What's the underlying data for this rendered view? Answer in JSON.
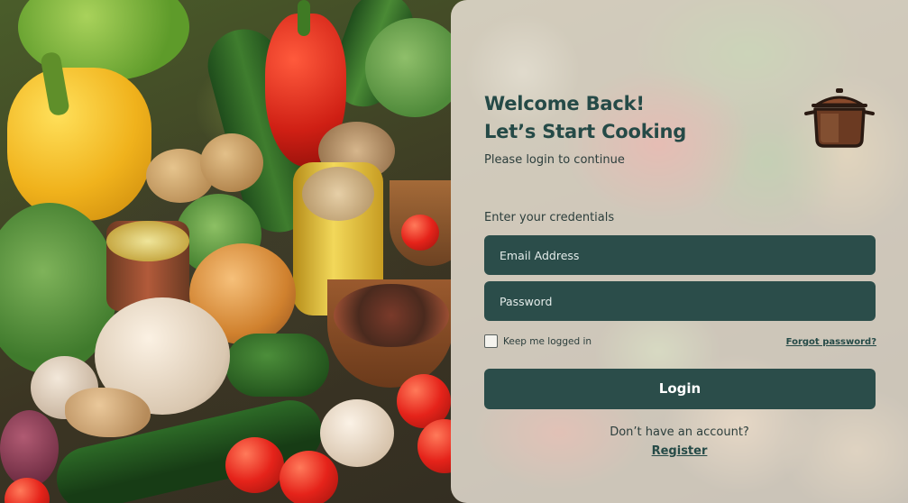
{
  "login": {
    "welcome_line1": "Welcome Back!",
    "welcome_line2": "Let’s Start Cooking",
    "subtitle": "Please login to continue",
    "credentials_label": "Enter your credentials",
    "email_placeholder": "Email Address",
    "password_placeholder": "Password",
    "remember_label": "Keep me logged in",
    "forgot_link": "Forgot password?",
    "login_button": "Login",
    "no_account_text": "Don’t have an account?",
    "register_link": "Register"
  },
  "icons": {
    "brand": "cooking-pot-icon"
  },
  "colors": {
    "primary": "#2b4d4a",
    "heading": "#254a47",
    "pot_body": "#6b3a22"
  }
}
